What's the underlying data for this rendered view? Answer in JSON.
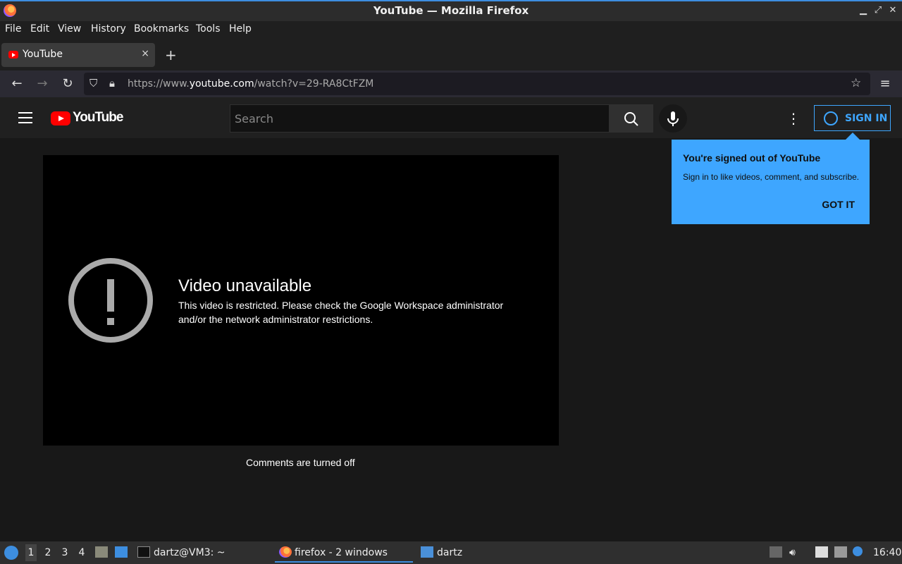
{
  "window": {
    "title": "YouTube — Mozilla Firefox"
  },
  "menu": [
    "File",
    "Edit",
    "View",
    "History",
    "Bookmarks",
    "Tools",
    "Help"
  ],
  "tab": {
    "label": "YouTube",
    "close": "×",
    "new_tab": "+"
  },
  "url": {
    "prefix": "https://www.",
    "domain": "youtube.com",
    "path": "/watch?v=29-RA8CtFZM"
  },
  "youtube": {
    "logo_text": "YouTube",
    "search_placeholder": "Search",
    "sign_in": "SIGN IN",
    "error_title": "Video unavailable",
    "error_message": "This video is restricted. Please check the Google Workspace administrator and/or the network administrator restrictions.",
    "comments": "Comments are turned off",
    "popup": {
      "heading": "You're signed out of YouTube",
      "body": "Sign in to like videos, comment, and subscribe.",
      "button": "GOT IT"
    }
  },
  "taskbar": {
    "workspaces": [
      "1",
      "2",
      "3",
      "4"
    ],
    "terminal": "dartz@VM3: ~",
    "firefox": "firefox - 2 windows",
    "folder": "dartz",
    "clock": "16:40"
  },
  "colors": {
    "accent": "#3ea6ff",
    "yt_red": "#ff0000"
  }
}
